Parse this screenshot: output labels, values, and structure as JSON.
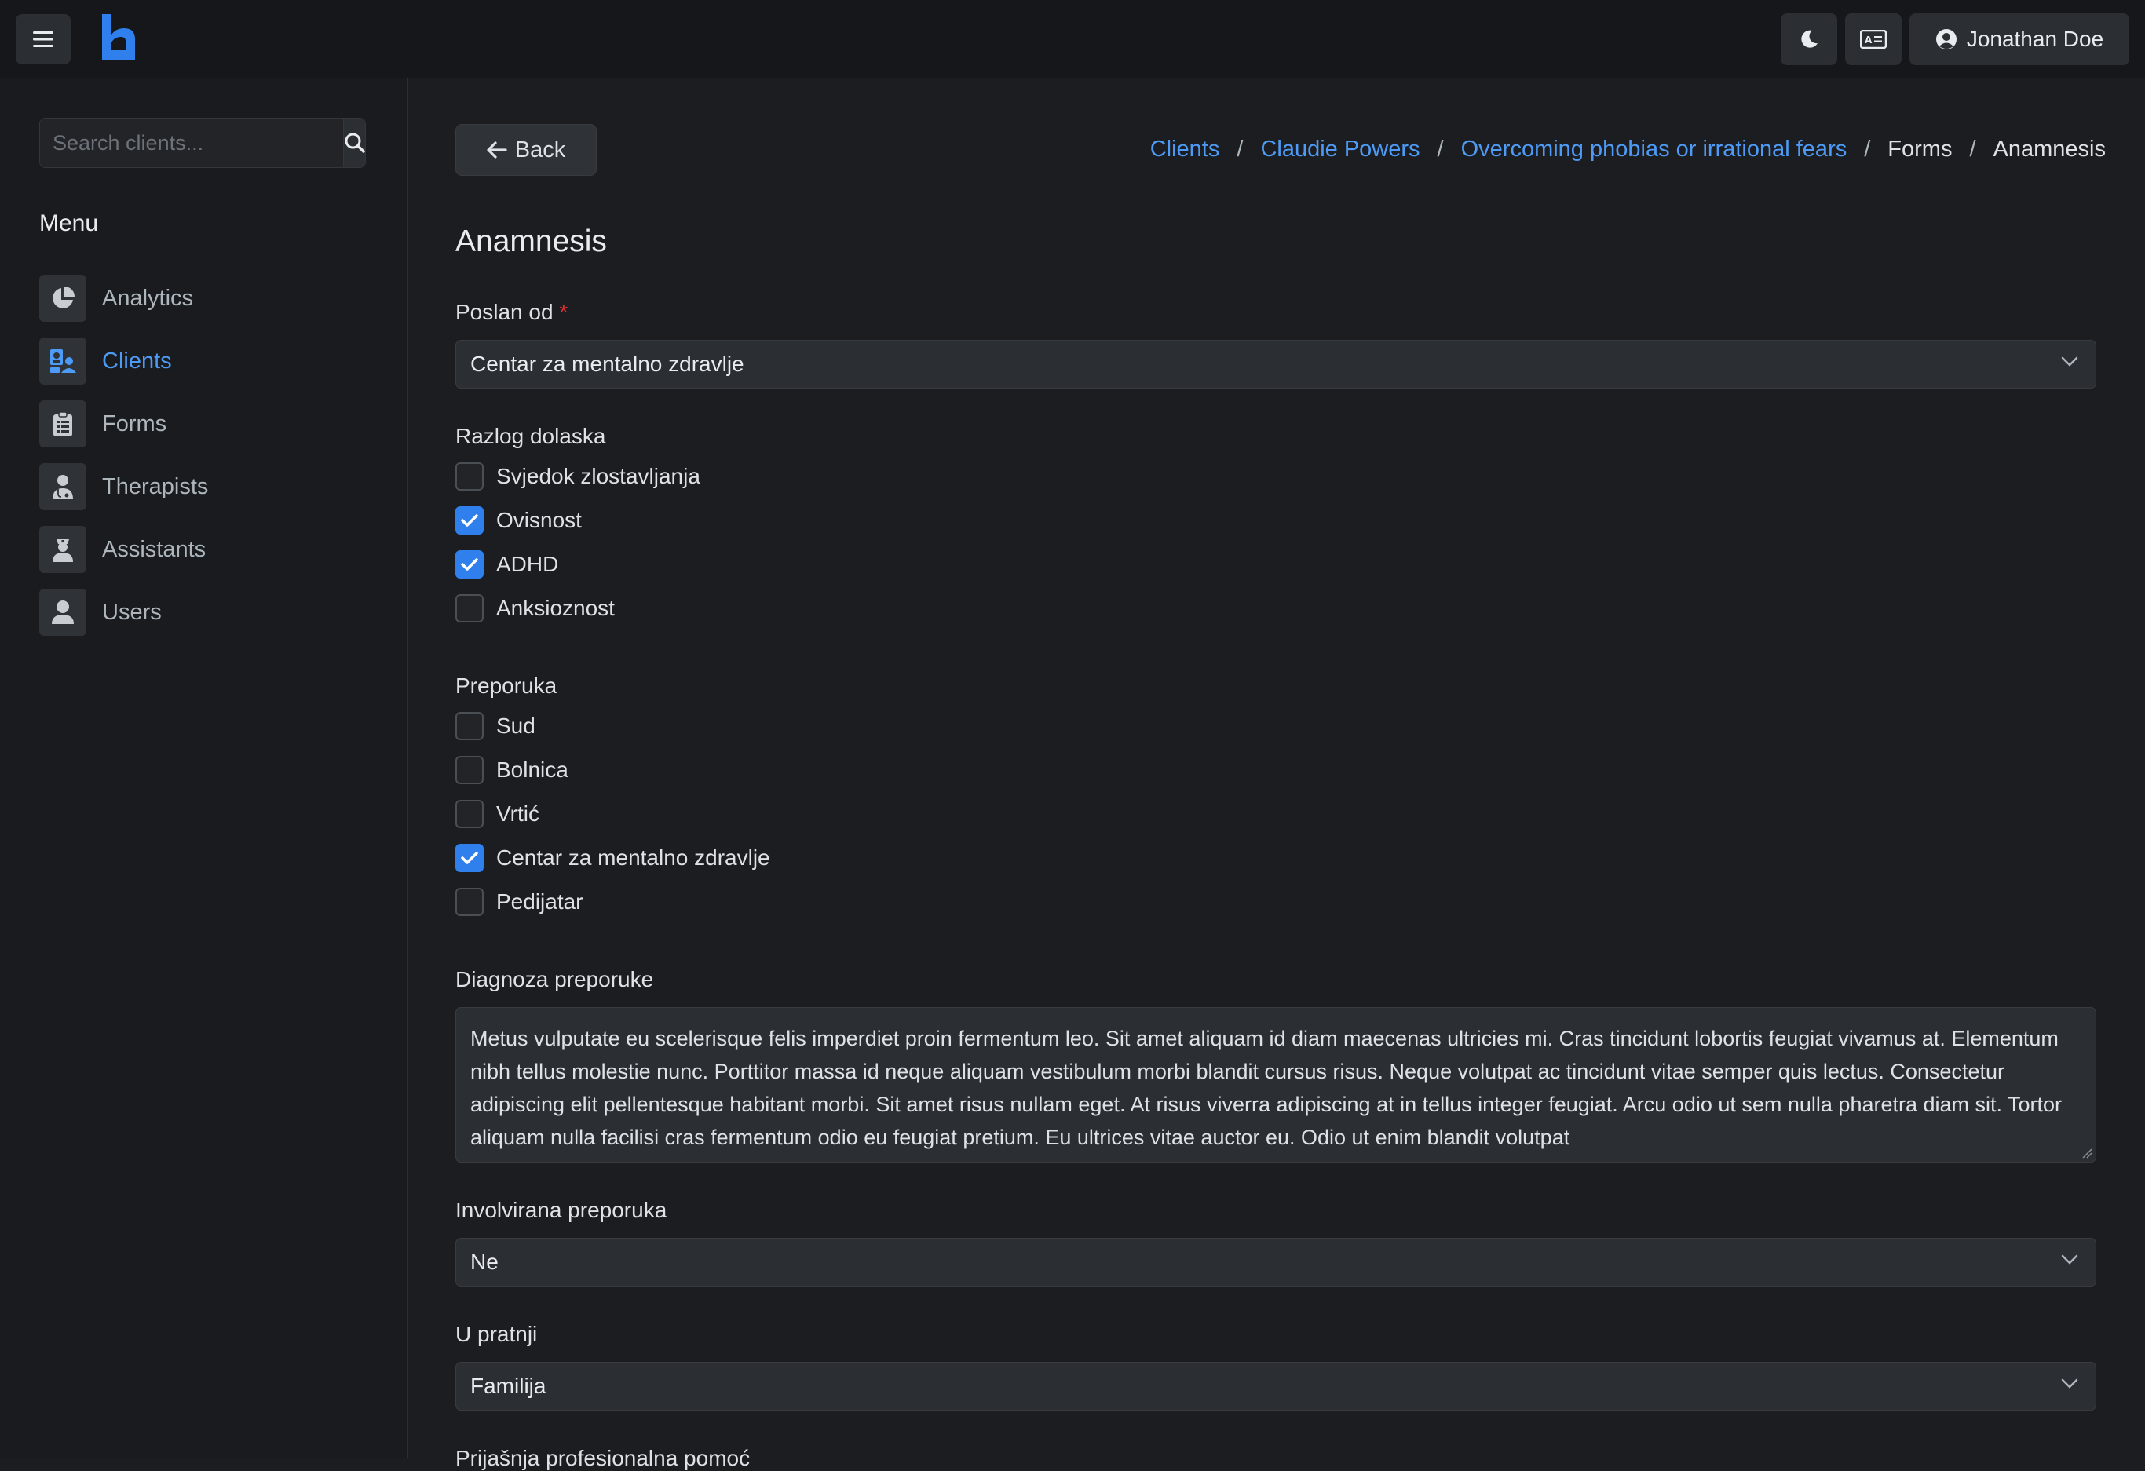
{
  "header": {
    "user_name": "Jonathan Doe"
  },
  "colors": {
    "accent": "#4d9bf6",
    "checkbox_checked": "#2f80ed",
    "background": "#1c1d20",
    "required": "#e03131"
  },
  "sidebar": {
    "search_placeholder": "Search clients...",
    "menu_title": "Menu",
    "items": [
      {
        "label": "Analytics",
        "icon": "pie-chart-icon"
      },
      {
        "label": "Clients",
        "icon": "clients-icon"
      },
      {
        "label": "Forms",
        "icon": "clipboard-icon"
      },
      {
        "label": "Therapists",
        "icon": "doctor-icon"
      },
      {
        "label": "Assistants",
        "icon": "nurse-icon"
      },
      {
        "label": "Users",
        "icon": "user-icon"
      }
    ],
    "active": "Clients"
  },
  "main": {
    "back_label": "Back",
    "breadcrumb": [
      "Clients",
      "Claudie Powers",
      "Overcoming phobias or irrational fears",
      "Forms",
      "Anamnesis"
    ],
    "page_title": "Anamnesis"
  },
  "form": {
    "poslan_od": {
      "label": "Poslan od",
      "required_mark": "*",
      "value": "Centar za mentalno zdravlje"
    },
    "razlog_dolaska": {
      "label": "Razlog dolaska",
      "options": [
        {
          "label": "Svjedok zlostavljanja",
          "checked": false
        },
        {
          "label": "Ovisnost",
          "checked": true
        },
        {
          "label": "ADHD",
          "checked": true
        },
        {
          "label": "Anksioznost",
          "checked": false
        }
      ]
    },
    "preporuka": {
      "label": "Preporuka",
      "options": [
        {
          "label": "Sud",
          "checked": false
        },
        {
          "label": "Bolnica",
          "checked": false
        },
        {
          "label": "Vrtić",
          "checked": false
        },
        {
          "label": "Centar za mentalno zdravlje",
          "checked": true
        },
        {
          "label": "Pedijatar",
          "checked": false
        }
      ]
    },
    "diagnoza_preporuke": {
      "label": "Diagnoza preporuke",
      "value": "Metus vulputate eu scelerisque felis imperdiet proin fermentum leo. Sit amet aliquam id diam maecenas ultricies mi. Cras tincidunt lobortis feugiat vivamus at. Elementum nibh tellus molestie nunc. Porttitor massa id neque aliquam vestibulum morbi blandit cursus risus. Neque volutpat ac tincidunt vitae semper quis lectus. Consectetur adipiscing elit pellentesque habitant morbi. Sit amet risus nullam eget. At risus viverra adipiscing at in tellus integer feugiat. Arcu odio ut sem nulla pharetra diam sit. Tortor aliquam nulla facilisi cras fermentum odio eu feugiat pretium. Eu ultrices vitae auctor eu. Odio ut enim blandit volutpat"
    },
    "involvirana_preporuka": {
      "label": "Involvirana preporuka",
      "value": "Ne"
    },
    "u_pratnji": {
      "label": "U pratnji",
      "value": "Familija"
    },
    "prijasnja_pomoc": {
      "label": "Prijašnja profesionalna pomoć"
    }
  }
}
